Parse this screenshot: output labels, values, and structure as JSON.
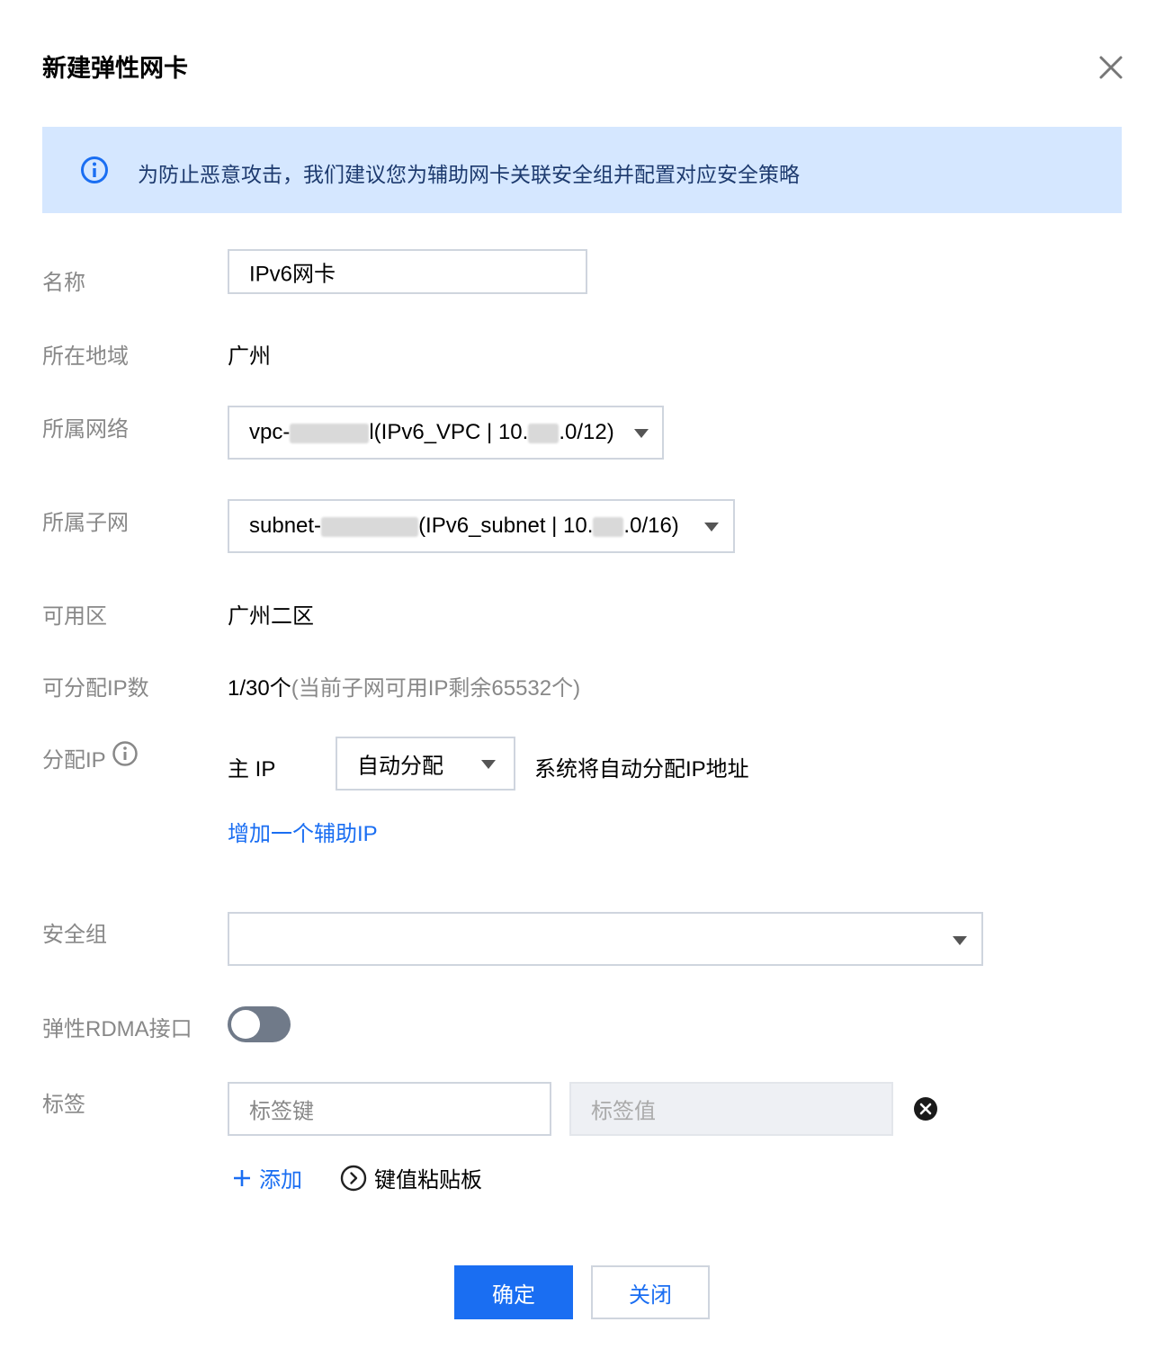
{
  "dialog": {
    "title": "新建弹性网卡"
  },
  "notice": {
    "text": "为防止恶意攻击，我们建议您为辅助网卡关联安全组并配置对应安全策略"
  },
  "form": {
    "name": {
      "label": "名称",
      "value": "IPv6网卡"
    },
    "region": {
      "label": "所在地域",
      "value": "广州"
    },
    "vpc": {
      "label": "所属网络",
      "prefix": "vpc-",
      "mid": "l(IPv6_VPC | 10.",
      "suffix": ".0/12)"
    },
    "subnet": {
      "label": "所属子网",
      "prefix": "subnet-",
      "mid": "(IPv6_subnet | 10.",
      "suffix": ".0/16)"
    },
    "zone": {
      "label": "可用区",
      "value": "广州二区"
    },
    "ip_count": {
      "label": "可分配IP数",
      "value": "1/30个",
      "note": "(当前子网可用IP剩余65532个)"
    },
    "assign_ip": {
      "label": "分配IP",
      "primary_label": "主 IP",
      "mode": "自动分配",
      "hint": "系统将自动分配IP地址",
      "add_link": "增加一个辅助IP"
    },
    "security_group": {
      "label": "安全组",
      "value": ""
    },
    "rdma": {
      "label": "弹性RDMA接口",
      "enabled": false
    },
    "tags": {
      "label": "标签",
      "key_placeholder": "标签键",
      "value_placeholder": "标签值",
      "add_label": "添加",
      "clipboard_label": "键值粘贴板"
    }
  },
  "footer": {
    "confirm": "确定",
    "close": "关闭"
  },
  "colors": {
    "primary": "#1a6ef2",
    "notice_bg": "#d5e7ff",
    "label": "#888888"
  }
}
